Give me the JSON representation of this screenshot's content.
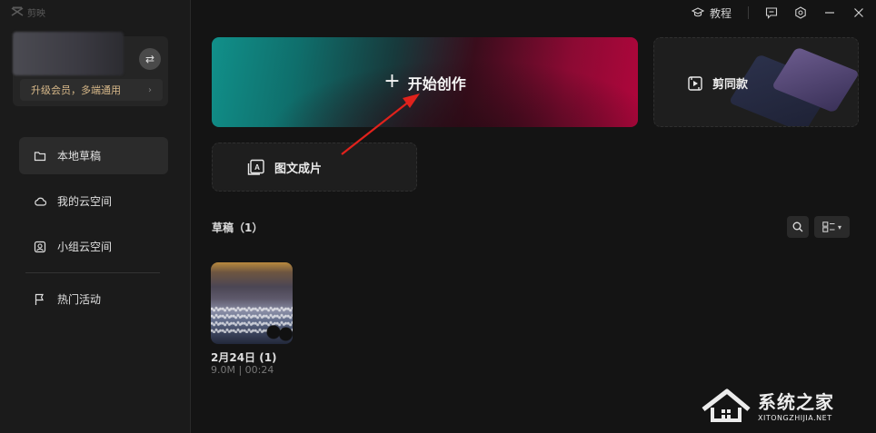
{
  "app": {
    "name": "剪映"
  },
  "topbar": {
    "tutorial_label": "教程"
  },
  "user": {
    "upgrade_label": "升级会员，多端通用"
  },
  "sidebar": {
    "items": [
      {
        "label": "本地草稿",
        "icon": "folder-icon",
        "active": true
      },
      {
        "label": "我的云空间",
        "icon": "cloud-icon",
        "active": false
      },
      {
        "label": "小组云空间",
        "icon": "group-cloud-icon",
        "active": false
      },
      {
        "label": "热门活动",
        "icon": "flag-icon",
        "active": false
      }
    ]
  },
  "main": {
    "create_label": "开始创作",
    "template_label": "剪同款",
    "text_to_video_label": "图文成片",
    "drafts_title": "草稿（1）",
    "drafts": [
      {
        "name": "2月24日 (1)",
        "meta": "9.0M | 00:24"
      }
    ]
  },
  "watermark": {
    "main": "系统之家",
    "sub": "XITONGZHIJIA.NET"
  },
  "colors": {
    "accent_red": "#b0063c",
    "accent_teal": "#11908a",
    "arrow": "#e0221c"
  }
}
